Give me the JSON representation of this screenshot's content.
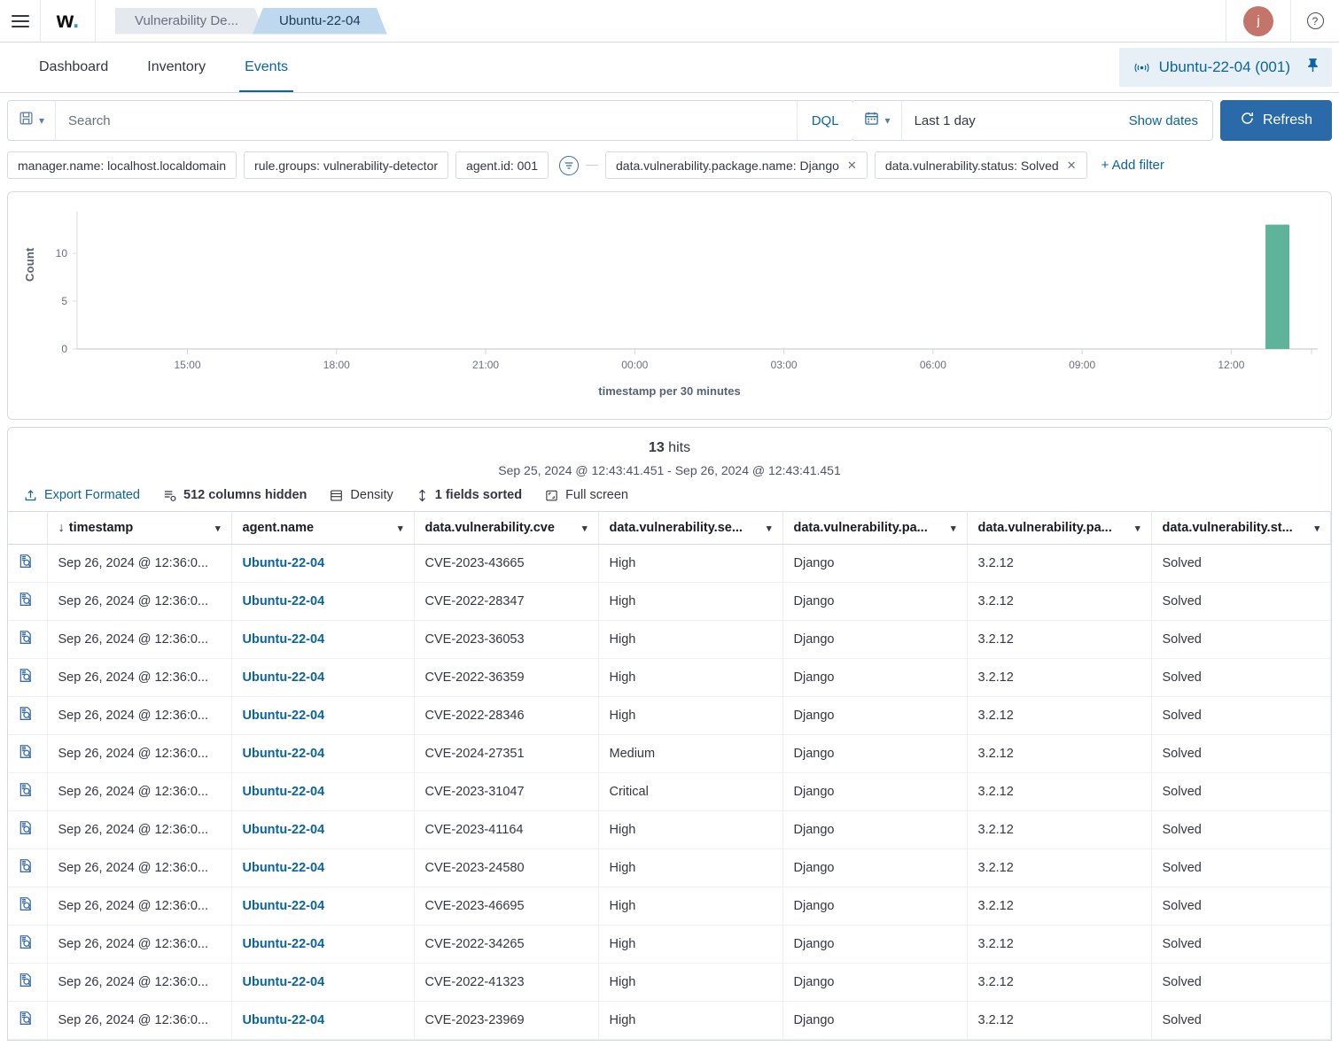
{
  "header": {
    "menu_icon": "hamburger-icon",
    "brand": "w",
    "brand_dot": ".",
    "breadcrumbs": [
      {
        "label": "Vulnerability De...",
        "active": false
      },
      {
        "label": "Ubuntu-22-04",
        "active": true
      }
    ],
    "avatar_initial": "j",
    "help_icon": "question-mark-icon"
  },
  "subnav": {
    "tabs": [
      {
        "label": "Dashboard",
        "active": false
      },
      {
        "label": "Inventory",
        "active": false
      },
      {
        "label": "Events",
        "active": true
      }
    ],
    "agent_pill": {
      "wifi_icon": "signal-icon",
      "label": "Ubuntu-22-04 (001)",
      "pin_icon": "pin-icon"
    }
  },
  "query": {
    "saved_query_icon": "save-icon",
    "saved_query_chevron": "chevron-down-icon",
    "search_placeholder": "Search",
    "search_value": "",
    "dql_label": "DQL",
    "calendar_icon": "calendar-icon",
    "calendar_chevron": "chevron-down-icon",
    "date_range": "Last 1 day",
    "show_dates_label": "Show dates",
    "refresh_label": "Refresh",
    "refresh_icon": "refresh-icon",
    "refresh_color": "#2a6aa8"
  },
  "filters": {
    "pills": [
      {
        "label": "manager.name: localhost.localdomain",
        "removable": false
      },
      {
        "label": "rule.groups: vulnerability-detector",
        "removable": false
      },
      {
        "label": "agent.id: 001",
        "removable": false
      }
    ],
    "group_icon": "filter-group-icon",
    "grouped_pills": [
      {
        "label": "data.vulnerability.package.name: Django",
        "removable": true
      },
      {
        "label": "data.vulnerability.status: Solved",
        "removable": true
      }
    ],
    "add_filter_label": "+ Add filter"
  },
  "chart_data": {
    "type": "bar",
    "title": "",
    "xlabel": "timestamp per 30 minutes",
    "ylabel": "Count",
    "xticks": [
      "15:00",
      "18:00",
      "21:00",
      "00:00",
      "03:00",
      "06:00",
      "09:00",
      "12:00"
    ],
    "yticks": [
      0,
      5,
      10
    ],
    "ylim": [
      0,
      13.8
    ],
    "grid": false,
    "legend": false,
    "bar_color": "#5fb398",
    "categories": [
      "12:30"
    ],
    "values": [
      13
    ]
  },
  "results": {
    "hits_count": "13",
    "hits_label": "hits",
    "range_text": "Sep 25, 2024 @ 12:43:41.451 - Sep 26, 2024 @ 12:43:41.451",
    "toolbar": [
      {
        "label": "Export Formated",
        "icon": "export-icon",
        "style": "link"
      },
      {
        "label": "512 columns hidden",
        "icon": "columns-icon",
        "style": "bold"
      },
      {
        "label": "Density",
        "icon": "density-icon",
        "style": "normal"
      },
      {
        "label": "1 fields sorted",
        "icon": "sort-icon",
        "style": "bold"
      },
      {
        "label": "Full screen",
        "icon": "fullscreen-icon",
        "style": "normal"
      }
    ],
    "columns": [
      {
        "label": "timestamp",
        "sorted": true,
        "sort_icon": "arrow-down-icon"
      },
      {
        "label": "agent.name",
        "sorted": false
      },
      {
        "label": "data.vulnerability.cve",
        "sorted": false
      },
      {
        "label": "data.vulnerability.se...",
        "sorted": false
      },
      {
        "label": "data.vulnerability.pa...",
        "sorted": false
      },
      {
        "label": "data.vulnerability.pa...",
        "sorted": false
      },
      {
        "label": "data.vulnerability.st...",
        "sorted": false
      }
    ],
    "rows": [
      {
        "expand_icon": "inspect-document-icon",
        "timestamp": "Sep 26, 2024 @ 12:36:0...",
        "agent_name": "Ubuntu-22-04",
        "cve": "CVE-2023-43665",
        "severity": "High",
        "package": "Django",
        "version": "3.2.12",
        "status": "Solved"
      },
      {
        "expand_icon": "inspect-document-icon",
        "timestamp": "Sep 26, 2024 @ 12:36:0...",
        "agent_name": "Ubuntu-22-04",
        "cve": "CVE-2022-28347",
        "severity": "High",
        "package": "Django",
        "version": "3.2.12",
        "status": "Solved"
      },
      {
        "expand_icon": "inspect-document-icon",
        "timestamp": "Sep 26, 2024 @ 12:36:0...",
        "agent_name": "Ubuntu-22-04",
        "cve": "CVE-2023-36053",
        "severity": "High",
        "package": "Django",
        "version": "3.2.12",
        "status": "Solved"
      },
      {
        "expand_icon": "inspect-document-icon",
        "timestamp": "Sep 26, 2024 @ 12:36:0...",
        "agent_name": "Ubuntu-22-04",
        "cve": "CVE-2022-36359",
        "severity": "High",
        "package": "Django",
        "version": "3.2.12",
        "status": "Solved"
      },
      {
        "expand_icon": "inspect-document-icon",
        "timestamp": "Sep 26, 2024 @ 12:36:0...",
        "agent_name": "Ubuntu-22-04",
        "cve": "CVE-2022-28346",
        "severity": "High",
        "package": "Django",
        "version": "3.2.12",
        "status": "Solved"
      },
      {
        "expand_icon": "inspect-document-icon",
        "timestamp": "Sep 26, 2024 @ 12:36:0...",
        "agent_name": "Ubuntu-22-04",
        "cve": "CVE-2024-27351",
        "severity": "Medium",
        "package": "Django",
        "version": "3.2.12",
        "status": "Solved"
      },
      {
        "expand_icon": "inspect-document-icon",
        "timestamp": "Sep 26, 2024 @ 12:36:0...",
        "agent_name": "Ubuntu-22-04",
        "cve": "CVE-2023-31047",
        "severity": "Critical",
        "package": "Django",
        "version": "3.2.12",
        "status": "Solved"
      },
      {
        "expand_icon": "inspect-document-icon",
        "timestamp": "Sep 26, 2024 @ 12:36:0...",
        "agent_name": "Ubuntu-22-04",
        "cve": "CVE-2023-41164",
        "severity": "High",
        "package": "Django",
        "version": "3.2.12",
        "status": "Solved"
      },
      {
        "expand_icon": "inspect-document-icon",
        "timestamp": "Sep 26, 2024 @ 12:36:0...",
        "agent_name": "Ubuntu-22-04",
        "cve": "CVE-2023-24580",
        "severity": "High",
        "package": "Django",
        "version": "3.2.12",
        "status": "Solved"
      },
      {
        "expand_icon": "inspect-document-icon",
        "timestamp": "Sep 26, 2024 @ 12:36:0...",
        "agent_name": "Ubuntu-22-04",
        "cve": "CVE-2023-46695",
        "severity": "High",
        "package": "Django",
        "version": "3.2.12",
        "status": "Solved"
      },
      {
        "expand_icon": "inspect-document-icon",
        "timestamp": "Sep 26, 2024 @ 12:36:0...",
        "agent_name": "Ubuntu-22-04",
        "cve": "CVE-2022-34265",
        "severity": "High",
        "package": "Django",
        "version": "3.2.12",
        "status": "Solved"
      },
      {
        "expand_icon": "inspect-document-icon",
        "timestamp": "Sep 26, 2024 @ 12:36:0...",
        "agent_name": "Ubuntu-22-04",
        "cve": "CVE-2022-41323",
        "severity": "High",
        "package": "Django",
        "version": "3.2.12",
        "status": "Solved"
      },
      {
        "expand_icon": "inspect-document-icon",
        "timestamp": "Sep 26, 2024 @ 12:36:0...",
        "agent_name": "Ubuntu-22-04",
        "cve": "CVE-2023-23969",
        "severity": "High",
        "package": "Django",
        "version": "3.2.12",
        "status": "Solved"
      }
    ]
  }
}
